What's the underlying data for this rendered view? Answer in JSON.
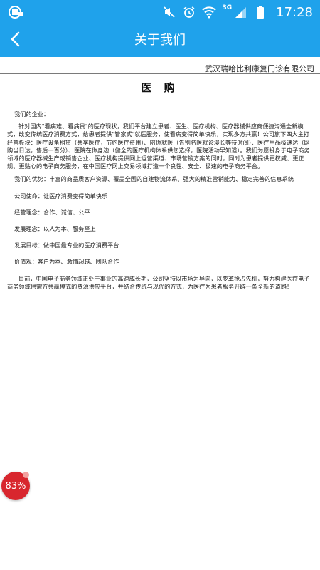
{
  "status_bar": {
    "network": "3G",
    "time": "17:28",
    "icons": [
      "app-notification-icon",
      "mute-icon",
      "alarm-icon",
      "wifi-icon",
      "signal-icon",
      "battery-icon"
    ]
  },
  "nav": {
    "back_icon": "chevron-left-icon",
    "title": "关于我们"
  },
  "document": {
    "company": "武汉瑞哈比利康复门诊有限公司",
    "title": "医 购",
    "greeting": "我们的企业：",
    "intro": "针对国内\"看病难、看病贵\"的医疗现状，我们平台建立患者、医生、医疗机构、医疗器械供应商便捷沟通全新模式，改变传统医疗消费方式，给患者提供\"管家式\"就医服务，使看病变得简单快乐，实现多方共赢！公司旗下四大主打经营板块：医疗设备租赁（共享医疗，节约医疗费用）、陪你就医（告别名医就诊漫长等待时间）、医疗用品极速达（网购当日达，售后一百分）、医院在你身边（健全的医疗机构体系供您选择，医院活动早知道）。我们为愿投身于电子商务领域的医疗器械生产或销售企业、医疗机构提供网上运营渠道、市场营销方案的同时，同时为患者提供更权威、更正规、更贴心的电子商务服务，在中国医疗网上交易领域打造一个良性、安全、极速的电子商务平台。",
    "advantage": "我们的优势：丰富的商品质客户资源、覆盖全国的自建物流体系、强大的精准营销能力、稳定完善的信息系统",
    "mission": "公司使命：让医疗消费变得简单快乐",
    "philosophy": "经营理念：合作、诚信、公平",
    "dev_concept": "发展理念：以人为本、服务至上",
    "dev_goal": "发展目标：做中国最专业的医疗消费平台",
    "values": "价值观：客户为本、激情超越、团队合作",
    "closing": "目前，中国电子商务领域正处于事业的高速成长期，公司坚持以市场为导向，以变革抢占先机，努力构建医疗电子商务领域供需方共赢模式的资源供应平台，并结合传统与现代的方式，为医疗为患者服务开辟一条全新的道路！"
  },
  "floating_badge": {
    "text": "83%",
    "color": "#d8262e"
  },
  "colors": {
    "header": "#1fa2eb"
  }
}
